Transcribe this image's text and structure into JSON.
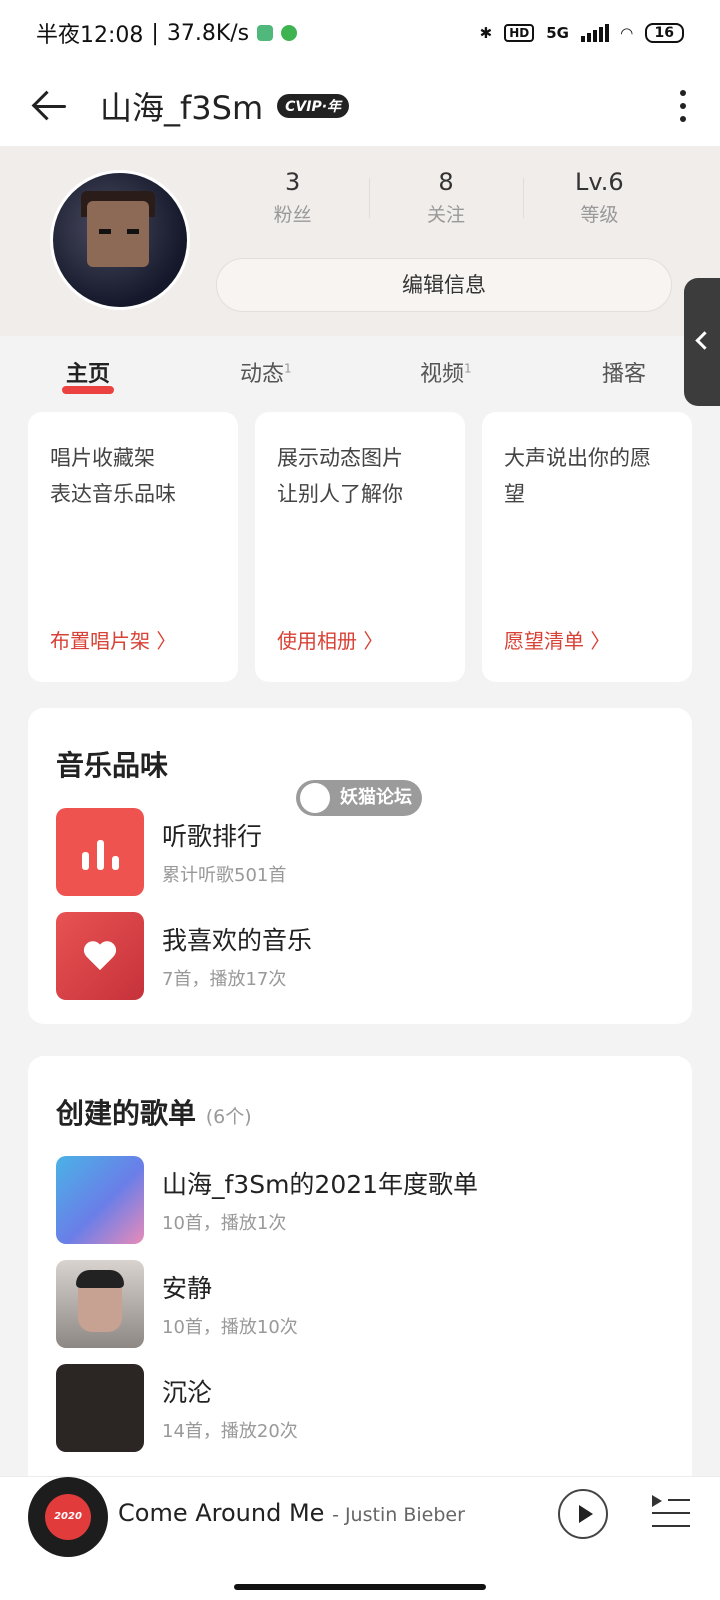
{
  "status_bar": {
    "time": "半夜12:08",
    "speed": "37.8K/s",
    "network": "5G",
    "hd": "HD",
    "battery": "16"
  },
  "header": {
    "username": "山海_f3Sm",
    "vip_badge": "CVIP·年"
  },
  "profile": {
    "stats": [
      {
        "value": "3",
        "label": "粉丝"
      },
      {
        "value": "8",
        "label": "关注"
      },
      {
        "value": "Lv.6",
        "label": "等级"
      }
    ],
    "edit_button": "编辑信息"
  },
  "tabs": [
    {
      "label": "主页",
      "count": ""
    },
    {
      "label": "动态",
      "count": "1"
    },
    {
      "label": "视频",
      "count": "1"
    },
    {
      "label": "播客",
      "count": ""
    }
  ],
  "feature_cards": [
    {
      "line1": "唱片收藏架",
      "line2": "表达音乐品味",
      "link": "布置唱片架 〉"
    },
    {
      "line1": "展示动态图片",
      "line2": "让别人了解你",
      "link": "使用相册 〉"
    },
    {
      "line1": "大声说出你的愿",
      "line2": "望",
      "link": "愿望清单 〉"
    }
  ],
  "music_taste": {
    "title": "音乐品味",
    "items": [
      {
        "title": "听歌排行",
        "subtitle": "累计听歌501首",
        "icon": "bar-chart-icon"
      },
      {
        "title": "我喜欢的音乐",
        "subtitle": "7首，播放17次",
        "icon": "heart-icon"
      }
    ]
  },
  "watermark": "妖猫论坛",
  "playlists": {
    "title": "创建的歌单",
    "count": "(6个)",
    "items": [
      {
        "title": "山海_f3Sm的2021年度歌单",
        "subtitle": "10首，播放1次"
      },
      {
        "title": "安静",
        "subtitle": "10首，播放10次"
      },
      {
        "title": "沉沦",
        "subtitle": "14首，播放20次"
      }
    ]
  },
  "player": {
    "song": "Come Around Me",
    "artist": "- Justin Bieber",
    "disc_label": "2020 HITS"
  }
}
